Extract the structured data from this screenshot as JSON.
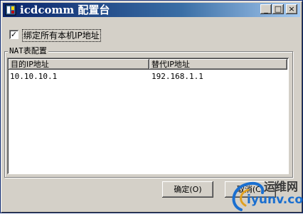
{
  "window": {
    "title": "icdcomm 配置台",
    "caption_buttons": {
      "minimize": "_",
      "maximize": "□",
      "close": "×"
    }
  },
  "bind_all": {
    "checked": true,
    "check_mark": "✓",
    "label": "绑定所有本机IP地址"
  },
  "nat": {
    "group_label": "NAT表配置",
    "columns": [
      "目的IP地址",
      "替代IP地址"
    ],
    "rows": [
      [
        "10.10.10.1",
        "192.168.1.1"
      ]
    ]
  },
  "buttons": {
    "ok_label": "确定(O)",
    "cancel_label": "取消(C)"
  },
  "watermark": {
    "cn": "运维网",
    "url": "iyunv.com"
  }
}
